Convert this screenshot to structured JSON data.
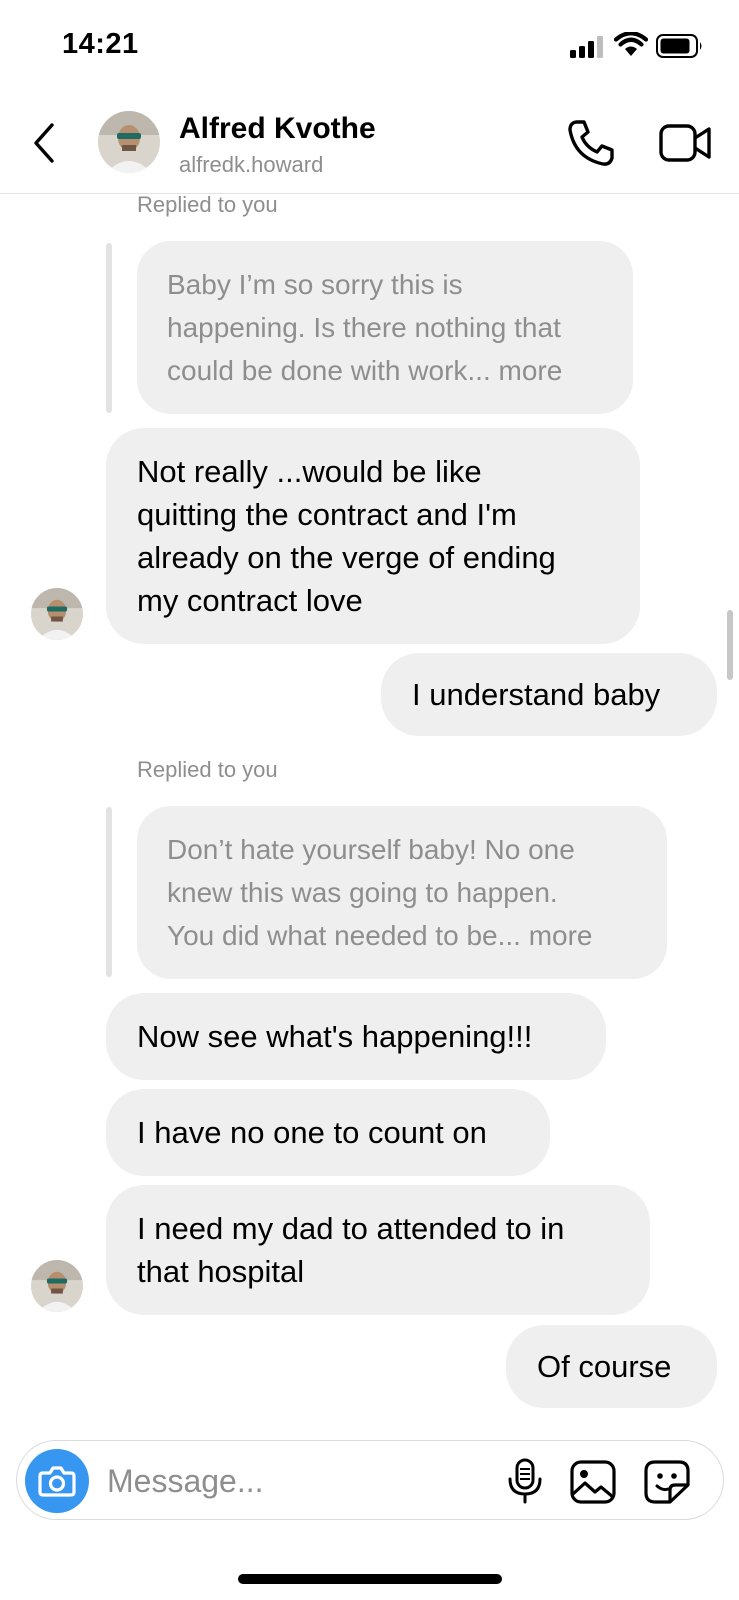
{
  "status_bar": {
    "time": "14:21"
  },
  "header": {
    "name": "Alfred Kvothe",
    "handle": "alfredk.howard"
  },
  "messages": {
    "reply_caption_1": "Replied to you",
    "quoted_1": [
      "Baby I’m so sorry this is",
      "happening. Is there nothing that",
      "could be done with work... more"
    ],
    "msg_1": [
      "Not really ...would be like",
      "quitting the contract and I'm",
      "already on the verge of ending",
      "my contract love"
    ],
    "msg_2": "I understand baby",
    "reply_caption_2": "Replied to you",
    "quoted_2": [
      "Don’t hate yourself baby! No one",
      "knew this was going to happen.",
      "You did what needed to be... more"
    ],
    "msg_3": "Now see what's happening!!!",
    "msg_4": "I have no one to count on",
    "msg_5": [
      "I need my dad to attended to in",
      "that hospital"
    ],
    "msg_6": "Of course"
  },
  "composer": {
    "placeholder": "Message..."
  },
  "colors": {
    "accent": "#3797f0",
    "bubble": "#efefef",
    "muted_text": "#8e8e8e"
  }
}
